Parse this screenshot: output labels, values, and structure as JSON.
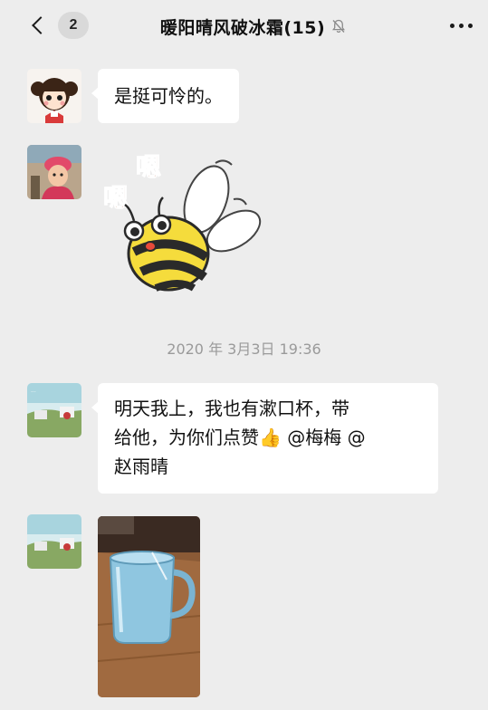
{
  "header": {
    "back_badge": "2",
    "title": "暖阳晴风破冰霜(15)",
    "muted_icon": "bell-off-icon",
    "more_icon": "more-dots-icon"
  },
  "messages": [
    {
      "type": "text",
      "avatar": "cartoon-girl-avatar",
      "text": "是挺可怜的。"
    },
    {
      "type": "sticker",
      "avatar": "child-photo-avatar",
      "sticker_text_1": "嗯",
      "sticker_text_2": "嗯"
    },
    {
      "type": "timestamp",
      "text": "2020 年 3月3日 19:36"
    },
    {
      "type": "text",
      "avatar": "landscape-avatar",
      "line1": "明天我上，我也有漱口杯，带",
      "line2": "给他，为你们点赞👍 @梅梅 @",
      "line3": "赵雨晴"
    },
    {
      "type": "image",
      "avatar": "landscape-avatar",
      "image": "blue-cup-photo"
    }
  ],
  "colors": {
    "background": "#ededed",
    "bubble": "#ffffff",
    "timestamp": "#9a9a9a",
    "sticker_text": "#b5552a"
  }
}
